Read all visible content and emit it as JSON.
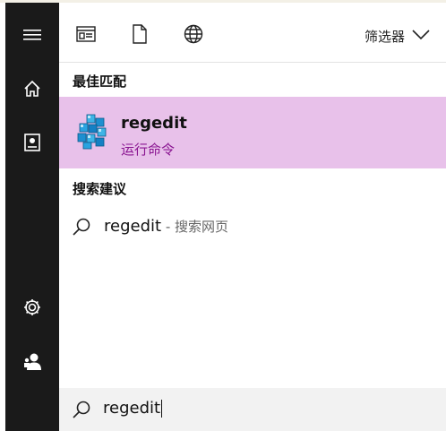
{
  "filter": {
    "label": "筛选器"
  },
  "best_match": {
    "heading": "最佳匹配",
    "title": "regedit",
    "subtitle": "运行命令"
  },
  "suggestions": {
    "heading": "搜索建议",
    "items": [
      {
        "query": "regedit",
        "separator": " - ",
        "hint": "搜索网页"
      }
    ]
  },
  "search": {
    "value": "regedit"
  },
  "icons": {
    "sidebar": [
      "hamburger-menu-icon",
      "home-icon",
      "document-library-icon",
      "settings-gear-icon",
      "user-account-icon"
    ],
    "toolbar": [
      "apps-filter-icon",
      "documents-filter-icon",
      "web-filter-icon",
      "chevron-down-icon"
    ],
    "best_match": "registry-editor-icon",
    "search": "search-icon"
  },
  "colors": {
    "sidebar_bg": "#1a1a1a",
    "best_match_bg": "#e8c1ea",
    "accent_text": "#8a1591",
    "search_bar_bg": "#f2f2f2"
  }
}
